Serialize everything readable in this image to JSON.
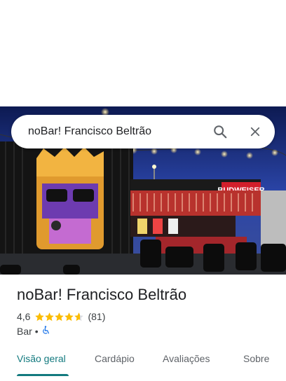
{
  "search": {
    "query": "noBar! Francisco Beltrão",
    "search_icon": "search-icon",
    "close_icon": "close-icon"
  },
  "place": {
    "name": "noBar! Francisco Beltrão",
    "rating": "4,6",
    "stars": 4.6,
    "reviews": "(81)",
    "category": "Bar",
    "separator": "•",
    "accessibility_icon": "wheelchair-icon",
    "image_alt": "noBar photo",
    "sign_text": "BUDWEISER"
  },
  "tabs": [
    {
      "label": "Visão geral",
      "active": true
    },
    {
      "label": "Cardápio",
      "active": false
    },
    {
      "label": "Avaliações",
      "active": false
    },
    {
      "label": "Sobre",
      "active": false
    }
  ],
  "colors": {
    "accent": "#137a7f",
    "star": "#fbbc04",
    "text": "#202124"
  }
}
